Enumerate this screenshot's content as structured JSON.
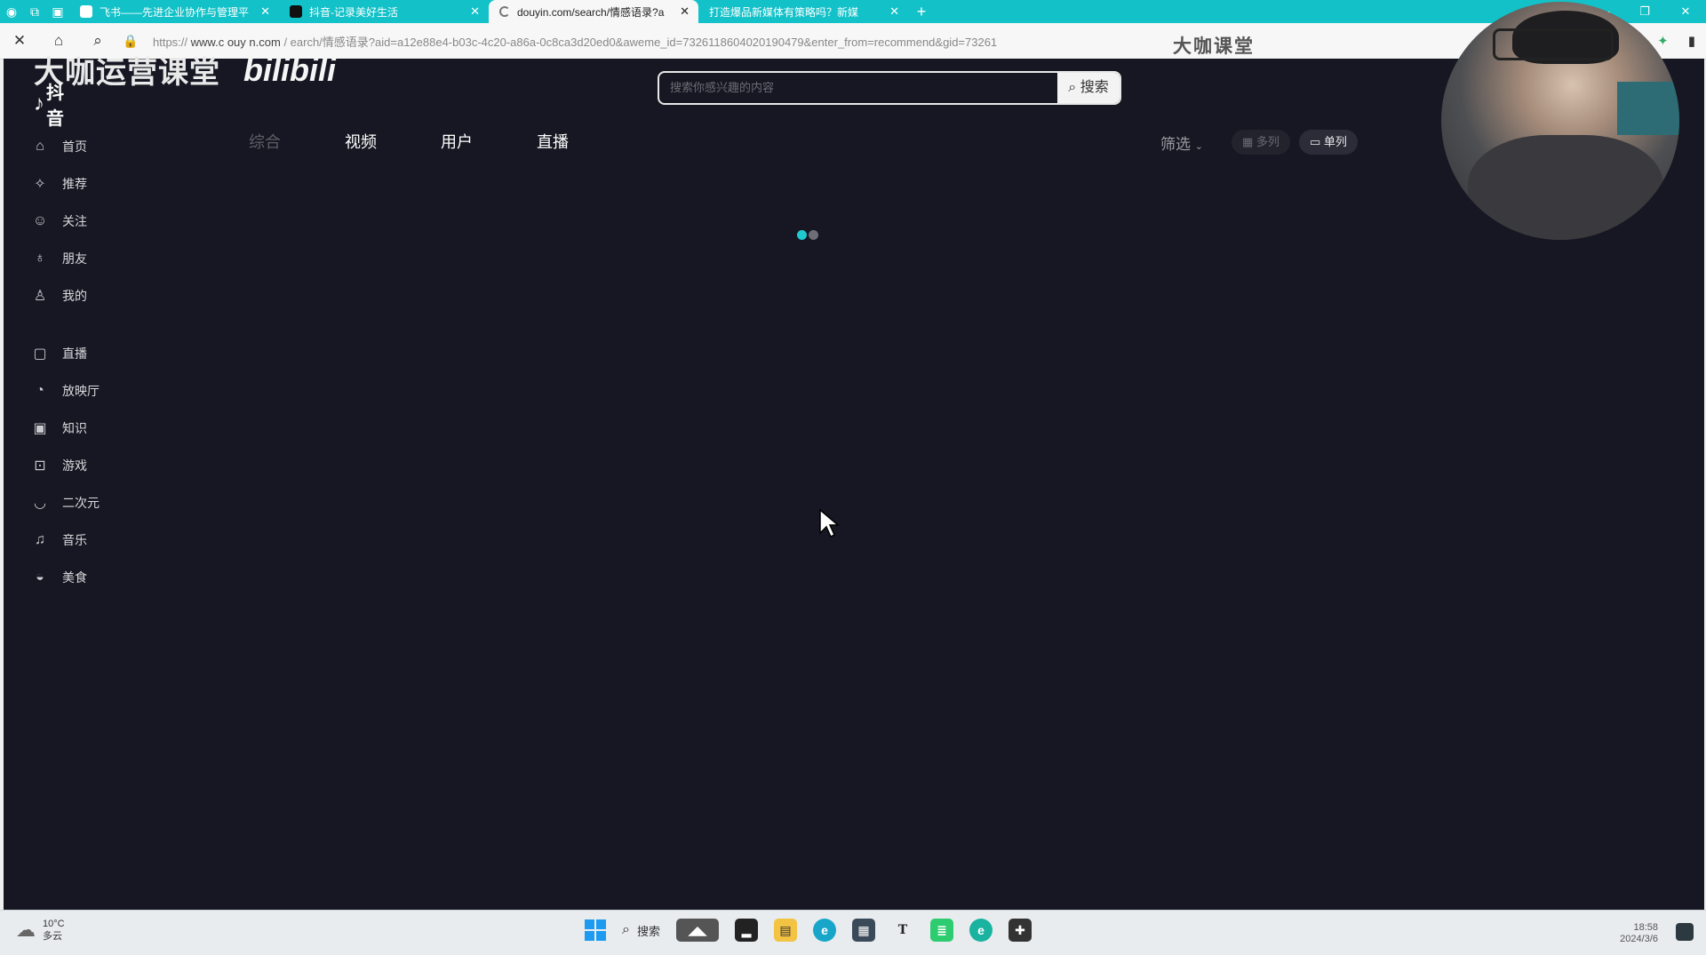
{
  "browser": {
    "tabs": [
      {
        "title": "飞书——先进企业协作与管理平",
        "active": false
      },
      {
        "title": "抖音-记录美好生活",
        "active": false
      },
      {
        "title": "douyin.com/search/情感语录?a",
        "active": true
      },
      {
        "title": "打造爆品新媒体有策略吗？新媒",
        "active": false
      }
    ],
    "new_tab": "+",
    "url_prefix": "https://",
    "url_host": "www.c  ouy  n.com",
    "url_rest": "/  earch/情感语录?aid=a12e88e4-b03c-4c20-a86a-0c8ca3d20ed0&aweme_id=7326118604020190479&enter_from=recommend&gid=73261"
  },
  "overlay": {
    "brand_watermark": "大咖课堂",
    "logo_watermark": "大咖运营课堂",
    "bili_watermark": "bilibili"
  },
  "app": {
    "logo": "抖音",
    "search": {
      "placeholder": "搜索你感兴趣的内容",
      "button": "搜索"
    },
    "sidebar": [
      {
        "label": "首页",
        "icon": "home-icon"
      },
      {
        "label": "推荐",
        "icon": "recommend-icon"
      },
      {
        "label": "关注",
        "icon": "follow-icon"
      },
      {
        "label": "朋友",
        "icon": "friends-icon"
      },
      {
        "label": "我的",
        "icon": "user-icon"
      },
      {
        "label": "直播",
        "icon": "live-icon"
      },
      {
        "label": "放映厅",
        "icon": "theater-icon"
      },
      {
        "label": "知识",
        "icon": "knowledge-icon"
      },
      {
        "label": "游戏",
        "icon": "game-icon"
      },
      {
        "label": "二次元",
        "icon": "anime-icon"
      },
      {
        "label": "音乐",
        "icon": "music-icon"
      },
      {
        "label": "美食",
        "icon": "food-icon"
      }
    ],
    "tabs": [
      "综合",
      "视频",
      "用户",
      "直播"
    ],
    "filter": "筛选",
    "view_multi": "多列",
    "view_single": "单列",
    "loading": true
  },
  "taskbar": {
    "weather_temp": "10°C",
    "weather_desc": "多云",
    "search": "搜索",
    "time": "18:58",
    "date": "2024/3/6"
  }
}
